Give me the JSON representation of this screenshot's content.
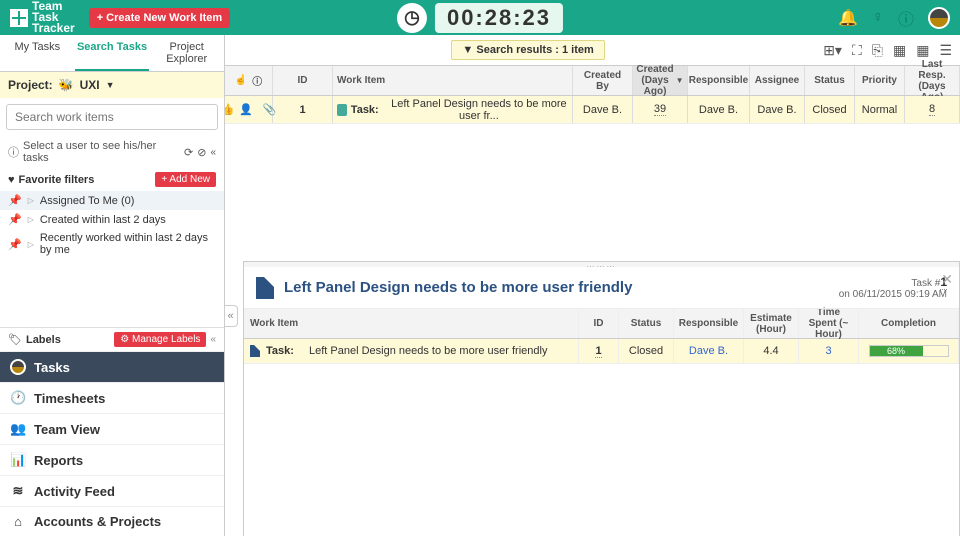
{
  "header": {
    "app_name": "Team\nTask\nTracker",
    "create_btn": "+ Create New Work Item",
    "timer": "00:28:23"
  },
  "tabs": {
    "my": "My Tasks",
    "search": "Search Tasks",
    "explorer": "Project Explorer"
  },
  "project": {
    "label": "Project:",
    "selected": "UXI"
  },
  "search": {
    "placeholder": "Search work items"
  },
  "select_user": "Select a user to see his/her tasks",
  "fav": {
    "header": "Favorite filters",
    "add": "+ Add New"
  },
  "filters": {
    "a": "Assigned To Me (0)",
    "b": "Created within last 2 days",
    "c": "Recently worked within last 2 days by me"
  },
  "labels": {
    "title": "Labels",
    "manage": "⚙ Manage Labels"
  },
  "nav": {
    "tasks": "Tasks",
    "timesheets": "Timesheets",
    "team": "Team View",
    "reports": "Reports",
    "feed": "Activity Feed",
    "accounts": "Accounts & Projects"
  },
  "results_badge": "▼ Search results : 1 item",
  "cols": {
    "id": "ID",
    "wi": "Work Item",
    "cb": "Created By",
    "cd": "Created (Days Ago)",
    "re": "Responsible",
    "as": "Assignee",
    "st": "Status",
    "pr": "Priority",
    "lr": "Last Resp. (Days Ago)"
  },
  "row": {
    "id": "1",
    "prefix": "Task:",
    "name": "Left Panel Design needs to be more user fr...",
    "created_by": "Dave B.",
    "created_days": "39",
    "responsible": "Dave B.",
    "assignee": "Dave B.",
    "status": "Closed",
    "priority": "Normal",
    "last_resp": "8"
  },
  "detail": {
    "title": "Left Panel Design needs to be more user friendly",
    "task_no_label": "Task #",
    "task_no": "1",
    "timestamp": "on 06/11/2015 09:19 AM",
    "cols": {
      "wi": "Work Item",
      "id": "ID",
      "st": "Status",
      "re": "Responsible",
      "es": "Estimate (Hour)",
      "ts": "Time Spent (~ Hour)",
      "co": "Completion"
    },
    "row": {
      "prefix": "Task:",
      "name": "Left Panel Design needs to be more user friendly",
      "id": "1",
      "status": "Closed",
      "responsible": "Dave B.",
      "estimate": "4.4",
      "time_spent": "3",
      "completion_pct": "68%"
    }
  }
}
